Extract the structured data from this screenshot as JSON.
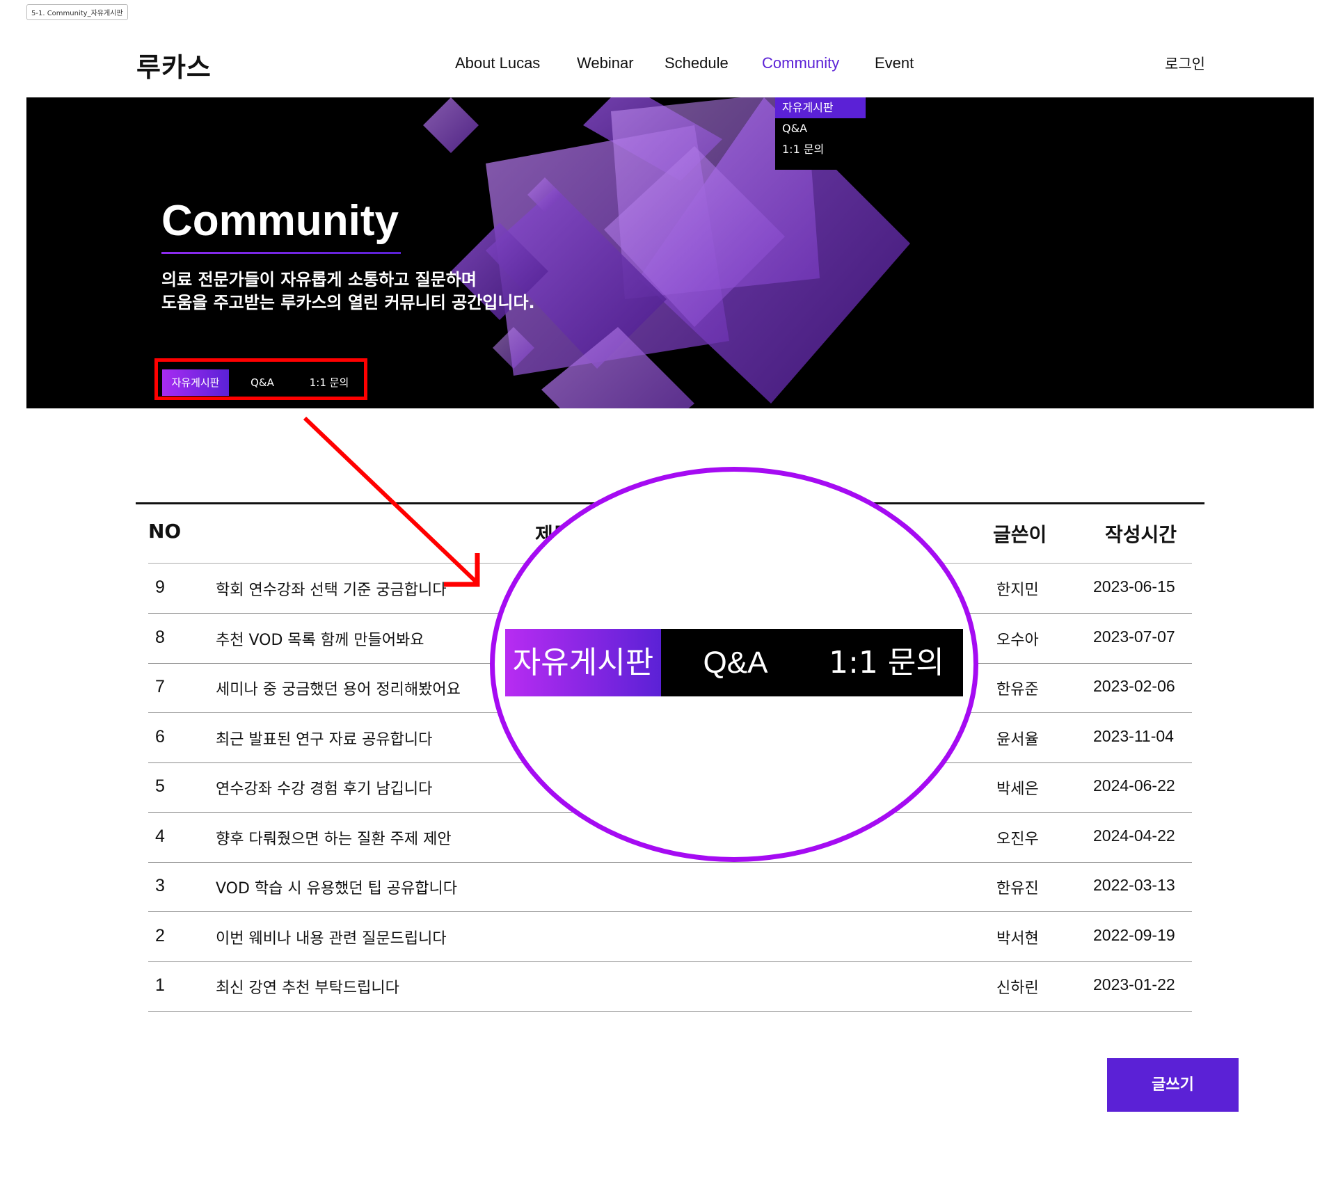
{
  "frame_label": "5-1. Community_자유게시판",
  "header": {
    "logo": "루카스",
    "nav": [
      {
        "label": "About Lucas"
      },
      {
        "label": "Webinar"
      },
      {
        "label": "Schedule"
      },
      {
        "label": "Community",
        "active": true
      },
      {
        "label": "Event"
      }
    ],
    "login": "로그인"
  },
  "dropdown": [
    "자유게시판",
    "Q&A",
    "1:1 문의"
  ],
  "hero": {
    "title": "Community",
    "desc_line1": "의료 전문가들이 자유롭게 소통하고 질문하며",
    "desc_line2": "도움을 주고받는 루카스의 열린 커뮤니티 공간입니다.",
    "tabs": [
      "자유게시판",
      "Q&A",
      "1:1 문의"
    ]
  },
  "table": {
    "headers": {
      "no": "NO",
      "title": "제목",
      "author": "글쓴이",
      "date": "작성시간"
    },
    "rows": [
      {
        "no": "9",
        "title": "학회 연수강좌 선택 기준 궁금합니다",
        "author": "한지민",
        "date": "2023-06-15"
      },
      {
        "no": "8",
        "title": "추천 VOD 목록 함께 만들어봐요",
        "author": "오수아",
        "date": "2023-07-07"
      },
      {
        "no": "7",
        "title": "세미나 중 궁금했던 용어 정리해봤어요",
        "author": "한유준",
        "date": "2023-02-06"
      },
      {
        "no": "6",
        "title": "최근 발표된 연구 자료 공유합니다",
        "author": "윤서율",
        "date": "2023-11-04"
      },
      {
        "no": "5",
        "title": "연수강좌 수강 경험 후기 남깁니다",
        "author": "박세은",
        "date": "2024-06-22"
      },
      {
        "no": "4",
        "title": "향후 다뤄줬으면 하는 질환 주제 제안",
        "author": "오진우",
        "date": "2024-04-22"
      },
      {
        "no": "3",
        "title": "VOD 학습 시 유용했던 팁 공유합니다",
        "author": "한유진",
        "date": "2022-03-13"
      },
      {
        "no": "2",
        "title": "이번 웨비나 내용 관련 질문드립니다",
        "author": "박서현",
        "date": "2022-09-19"
      },
      {
        "no": "1",
        "title": "최신 강연 추천 부탁드립니다",
        "author": "신하린",
        "date": "2023-01-22"
      }
    ]
  },
  "write_button": "글쓰기",
  "zoom_tabs": [
    "자유게시판",
    "Q&A",
    "1:1 문의"
  ],
  "colors": {
    "accent": "#5b21d6",
    "annotation_red": "#ff0000",
    "annotation_purple": "#a50bf2"
  }
}
